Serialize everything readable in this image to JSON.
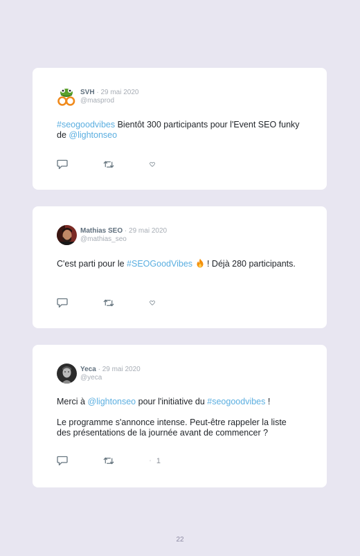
{
  "tweets": [
    {
      "name": "SVH",
      "separator": " · ",
      "date": "29 mai 2020",
      "handle": "@masprod",
      "avatar_icon": "frog-logo-icon",
      "paragraphs": [
        [
          {
            "text": "#seogoodvibes",
            "link": true
          },
          {
            "text": " Bientôt 300 participants pour l'Event SEO funky de ",
            "link": false
          },
          {
            "text": "@lightonseo",
            "link": true
          }
        ]
      ],
      "likes": ""
    },
    {
      "name": "Mathias SEO",
      "separator": " · ",
      "date": "29 mai 2020",
      "handle": "@mathias_seo",
      "avatar_icon": "person-photo-icon",
      "paragraphs": [
        [
          {
            "text": "C'est parti pour le ",
            "link": false
          },
          {
            "text": "#SEOGoodVibes",
            "link": true
          },
          {
            "text": " ",
            "link": false
          },
          {
            "emoji": "fire-emoji-icon"
          },
          {
            "text": " ! Déjà 280 participants.",
            "link": false
          }
        ]
      ],
      "likes": ""
    },
    {
      "name": "Yeca",
      "separator": " · ",
      "date": "29 mai 2020",
      "handle": "@yeca",
      "avatar_icon": "person-photo-icon",
      "paragraphs": [
        [
          {
            "text": "Merci à ",
            "link": false
          },
          {
            "text": "@lightonseo",
            "link": true
          },
          {
            "text": " pour l'initiative du ",
            "link": false
          },
          {
            "text": "#seogoodvibes",
            "link": true
          },
          {
            "text": " !",
            "link": false
          }
        ],
        [
          {
            "text": "Le programme s'annonce intense. Peut-être rappeler la liste des présentations de la journée avant de commencer ?",
            "link": false
          }
        ]
      ],
      "likes": "1"
    }
  ],
  "icons": {
    "reply": "reply-icon",
    "retweet": "retweet-icon",
    "like": "heart-icon"
  },
  "colors": {
    "background": "#e8e6f1",
    "card": "#ffffff",
    "link": "#5aaee0",
    "name": "#5f6f7d",
    "muted": "#a7adb5",
    "icon": "#66757f"
  },
  "page_number": "22"
}
